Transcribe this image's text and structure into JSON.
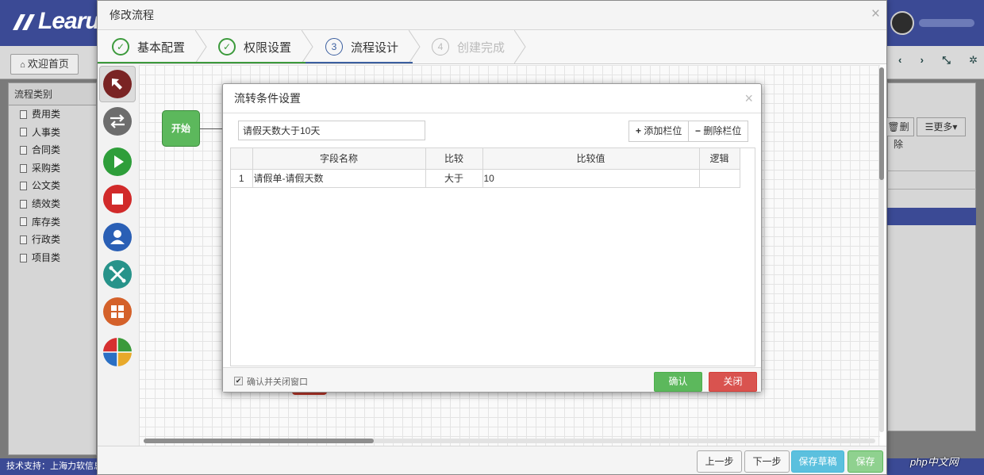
{
  "app": {
    "logo_text": "Learu",
    "home_tab": "欢迎首页",
    "sidebar_title": "流程类别",
    "sidebar_items": [
      "费用类",
      "人事类",
      "合同类",
      "采购类",
      "公文类",
      "绩效类",
      "库存类",
      "行政类",
      "项目类"
    ],
    "right_buttons": {
      "delete": "删除",
      "more": "更多"
    },
    "footer_text": "技术支持：上海力软信息",
    "watermark": "php中文网"
  },
  "main_dialog": {
    "title": "修改流程",
    "steps": [
      {
        "index": "✓",
        "label": "基本配置",
        "state": "done"
      },
      {
        "index": "✓",
        "label": "权限设置",
        "state": "done"
      },
      {
        "index": "3",
        "label": "流程设计",
        "state": "current"
      },
      {
        "index": "4",
        "label": "创建完成",
        "state": "future"
      }
    ],
    "start_node": "开始",
    "footer_buttons": {
      "prev": "上一步",
      "next": "下一步",
      "save_draft": "保存草稿",
      "save": "保存"
    }
  },
  "condition_dialog": {
    "title": "流转条件设置",
    "condition_name": "请假天数大于10天",
    "add_column": "添加栏位",
    "delete_column": "删除栏位",
    "columns": [
      "字段名称",
      "比较",
      "比较值",
      "逻辑"
    ],
    "rows": [
      {
        "index": "1",
        "field": "请假单-请假天数",
        "compare": "大于",
        "value": "10",
        "logic": ""
      }
    ],
    "confirm_close_label": "确认并关闭窗口",
    "ok": "确认",
    "close": "关闭"
  },
  "colors": {
    "brand": "#3b4a95",
    "done_step": "#3c9a3c",
    "current_step": "#3b5fa0",
    "ok_button": "#5cb85c",
    "close_button": "#d9534f",
    "save_draft": "#5bc0de"
  }
}
